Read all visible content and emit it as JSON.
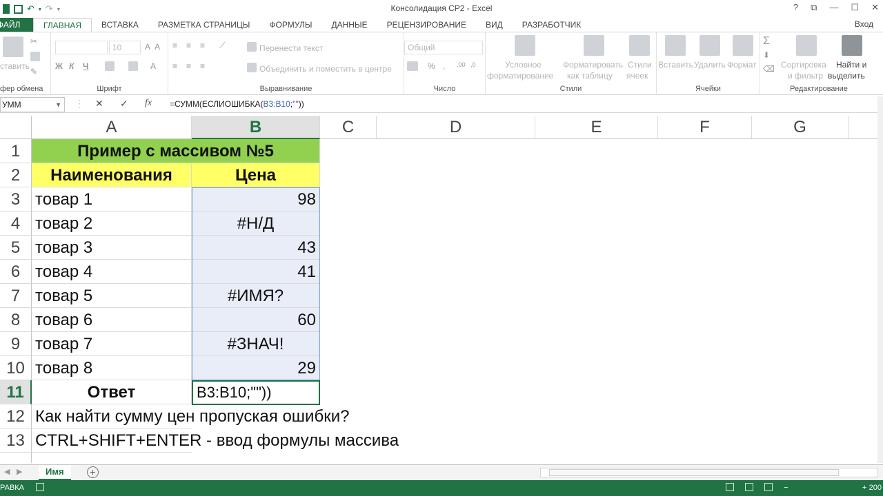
{
  "window": {
    "title": "Консолидация СР2 - Excel",
    "controls": [
      "?",
      "⧉",
      "—",
      "☐",
      "✕"
    ]
  },
  "tabs": [
    {
      "label": "ФАЙЛ"
    },
    {
      "label": "ГЛАВНАЯ"
    },
    {
      "label": "ВСТАВКА"
    },
    {
      "label": "РАЗМЕТКА СТРАНИЦЫ"
    },
    {
      "label": "ФОРМУЛЫ"
    },
    {
      "label": "ДАННЫЕ"
    },
    {
      "label": "РЕЦЕНЗИРОВАНИЕ"
    },
    {
      "label": "ВИД"
    },
    {
      "label": "РАЗРАБОТЧИК"
    }
  ],
  "signin": "Вход",
  "ribbon": {
    "clipboard": {
      "paste": "ставить",
      "group": "фер обмена"
    },
    "font": {
      "size": "10",
      "bold": "Ж",
      "italic": "К",
      "underline": "Ч",
      "group": "Шрифт"
    },
    "alignment": {
      "wrap": "Перенести текст",
      "merge": "Объединить и поместить в центре",
      "group": "Выравнивание"
    },
    "number": {
      "format": "Общий",
      "percent": "%",
      "group": "Число"
    },
    "styles": {
      "conditional": "Условное",
      "conditional2": "форматирование",
      "table": "Форматировать",
      "table2": "как таблицу",
      "cell_styles": "Стили",
      "cell_styles2": "ячеек",
      "group": "Стили"
    },
    "cells": {
      "insert": "Вставить",
      "delete": "Удалить",
      "format": "Формат",
      "group": "Ячейки"
    },
    "editing": {
      "sum": "Σ",
      "sort": "Сортировка",
      "sort2": "и фильтр",
      "find": "Найти и",
      "find2": "выделить",
      "group": "Редактирование"
    }
  },
  "formula_bar": {
    "name_box": "УММ",
    "cancel": "✕",
    "enter": "✓",
    "fx": "fx",
    "formula_prefix": "=СУММ(ЕСЛИОШИБКА(",
    "formula_ref": "B3:B10",
    "formula_mid": ";",
    "formula_quotes": "\"\"",
    "formula_suffix": "))"
  },
  "columns": [
    "A",
    "B",
    "C",
    "D",
    "E",
    "F",
    "G"
  ],
  "rows": [
    "1",
    "2",
    "3",
    "4",
    "5",
    "6",
    "7",
    "8",
    "9",
    "10",
    "11",
    "12",
    "13"
  ],
  "sheet": {
    "title": "Пример с массивом №5",
    "header_name": "Наименования",
    "header_price": "Цена",
    "items": [
      {
        "name": "товар 1",
        "price": "98"
      },
      {
        "name": "товар 2",
        "price": "#Н/Д"
      },
      {
        "name": "товар 3",
        "price": "43"
      },
      {
        "name": "товар 4",
        "price": "41"
      },
      {
        "name": "товар 5",
        "price": "#ИМЯ?"
      },
      {
        "name": "товар 6",
        "price": "60"
      },
      {
        "name": "товар 7",
        "price": "#ЗНАЧ!"
      },
      {
        "name": "товар 8",
        "price": "29"
      }
    ],
    "answer_label": "Ответ",
    "answer_edit": "B3:B10;\"\"))",
    "note1": "Как найти сумму цен пропуская ошибки?",
    "note2": "CTRL+SHIFT+ENTER - ввод формулы массива"
  },
  "sheet_tabs": {
    "active": "Имя",
    "add": "+"
  },
  "status": {
    "mode": "РАВКА",
    "zoom": "200"
  },
  "colors": {
    "accent": "#217346",
    "title_fill": "#92d050",
    "header_fill": "#ffff66",
    "range_fill": "#e8edf7"
  }
}
